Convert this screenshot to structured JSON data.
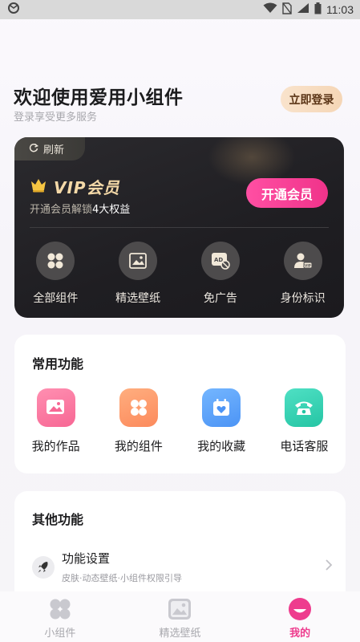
{
  "status_bar": {
    "time": "11:03"
  },
  "header": {
    "title": "欢迎使用爱用小组件",
    "subtitle": "登录享受更多服务",
    "login_label": "立即登录"
  },
  "vip": {
    "refresh_label": "刷新",
    "title": "VIP会员",
    "desc_prefix": "开通会员解锁",
    "desc_highlight": "4大权益",
    "open_label": "开通会员",
    "benefits": [
      {
        "label": "全部组件",
        "icon": "widgets-icon"
      },
      {
        "label": "精选壁纸",
        "icon": "wallpaper-icon"
      },
      {
        "label": "免广告",
        "icon": "no-ad-icon"
      },
      {
        "label": "身份标识",
        "icon": "vip-badge-icon"
      }
    ]
  },
  "common": {
    "title": "常用功能",
    "items": [
      {
        "label": "我的作品",
        "icon": "my-works-icon"
      },
      {
        "label": "我的组件",
        "icon": "my-widgets-icon"
      },
      {
        "label": "我的收藏",
        "icon": "favorites-icon"
      },
      {
        "label": "电话客服",
        "icon": "phone-support-icon"
      }
    ]
  },
  "other": {
    "title": "其他功能",
    "settings_title": "功能设置",
    "settings_sub": "皮肤·动态壁纸·小组件权限引导"
  },
  "tabs": [
    {
      "label": "小组件",
      "active": false
    },
    {
      "label": "精选壁纸",
      "active": false
    },
    {
      "label": "我的",
      "active": true
    }
  ],
  "colors": {
    "accent_pink": "#ee3c8e",
    "vip_gold": "#f4d9a8",
    "card_dark": "#232226"
  }
}
